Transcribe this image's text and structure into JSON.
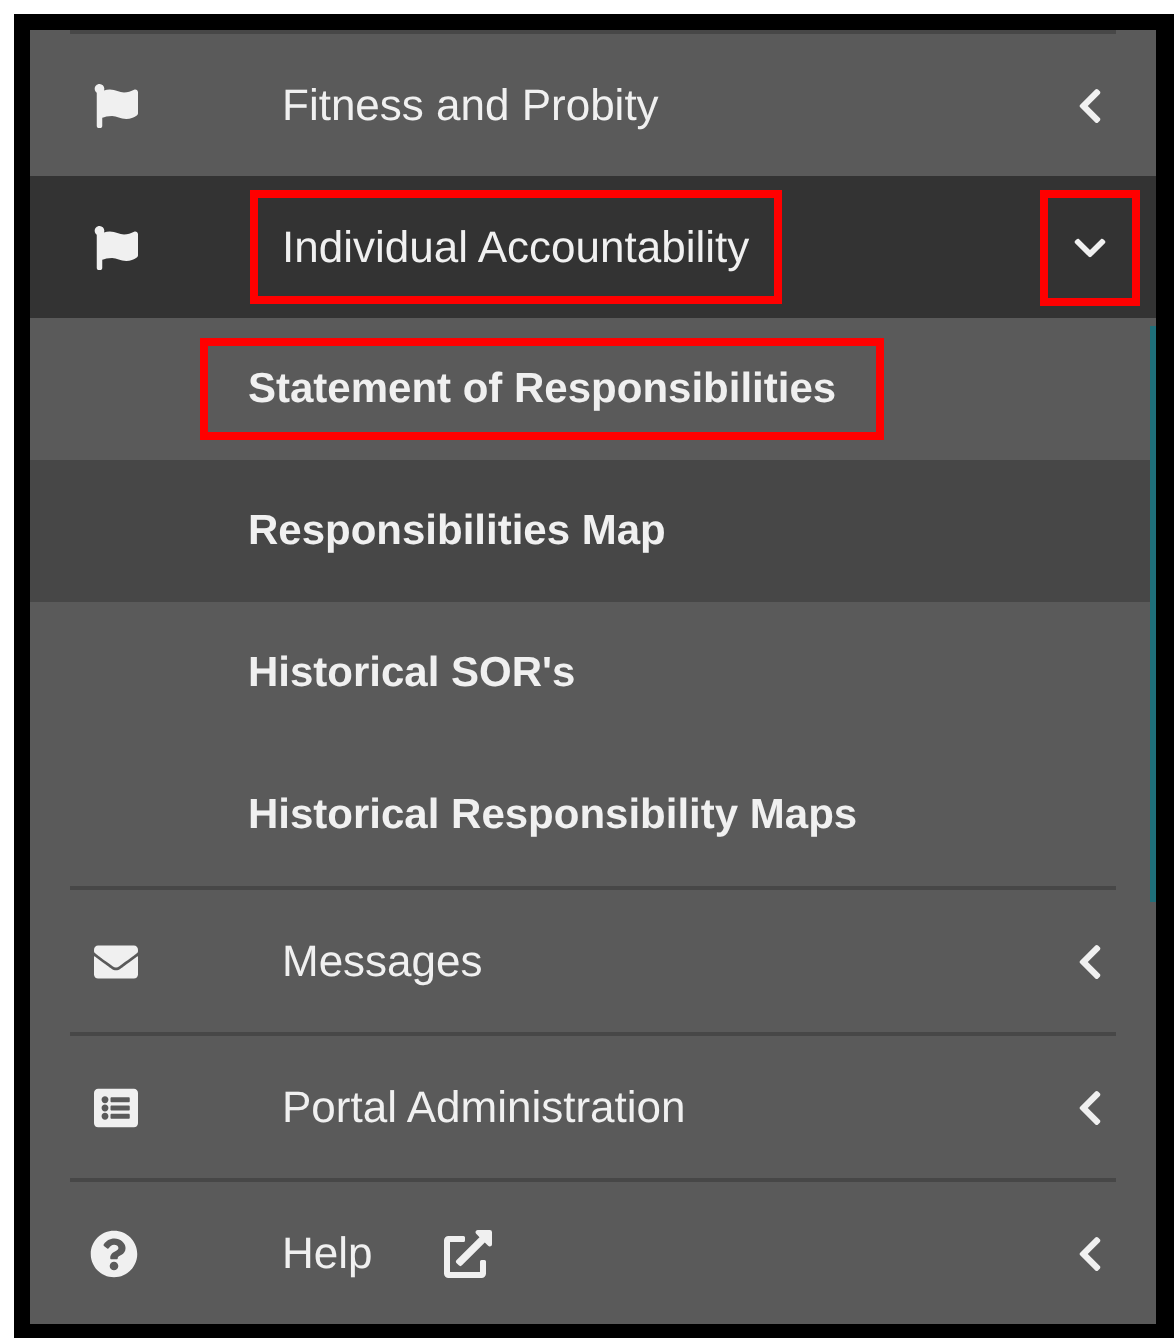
{
  "menu": [
    {
      "label": "Fitness and Probity",
      "expanded": false,
      "annotated": false,
      "chevron_annotated": false
    },
    {
      "label": "Individual Accountability",
      "expanded": true,
      "annotated": true,
      "chevron_annotated": true,
      "children": [
        {
          "label": "Statement of Responsibilities",
          "selected": false,
          "annotated": true
        },
        {
          "label": "Responsibilities Map",
          "selected": true,
          "annotated": false
        },
        {
          "label": "Historical SOR's",
          "selected": false,
          "annotated": false
        },
        {
          "label": "Historical Responsibility Maps",
          "selected": false,
          "annotated": false
        }
      ]
    },
    {
      "label": "Messages",
      "expanded": false,
      "annotated": false,
      "chevron_annotated": false
    },
    {
      "label": "Portal Administration",
      "expanded": false,
      "annotated": false,
      "chevron_annotated": false
    },
    {
      "label": "Help",
      "expanded": false,
      "annotated": false,
      "chevron_annotated": false,
      "external_link": true
    }
  ]
}
